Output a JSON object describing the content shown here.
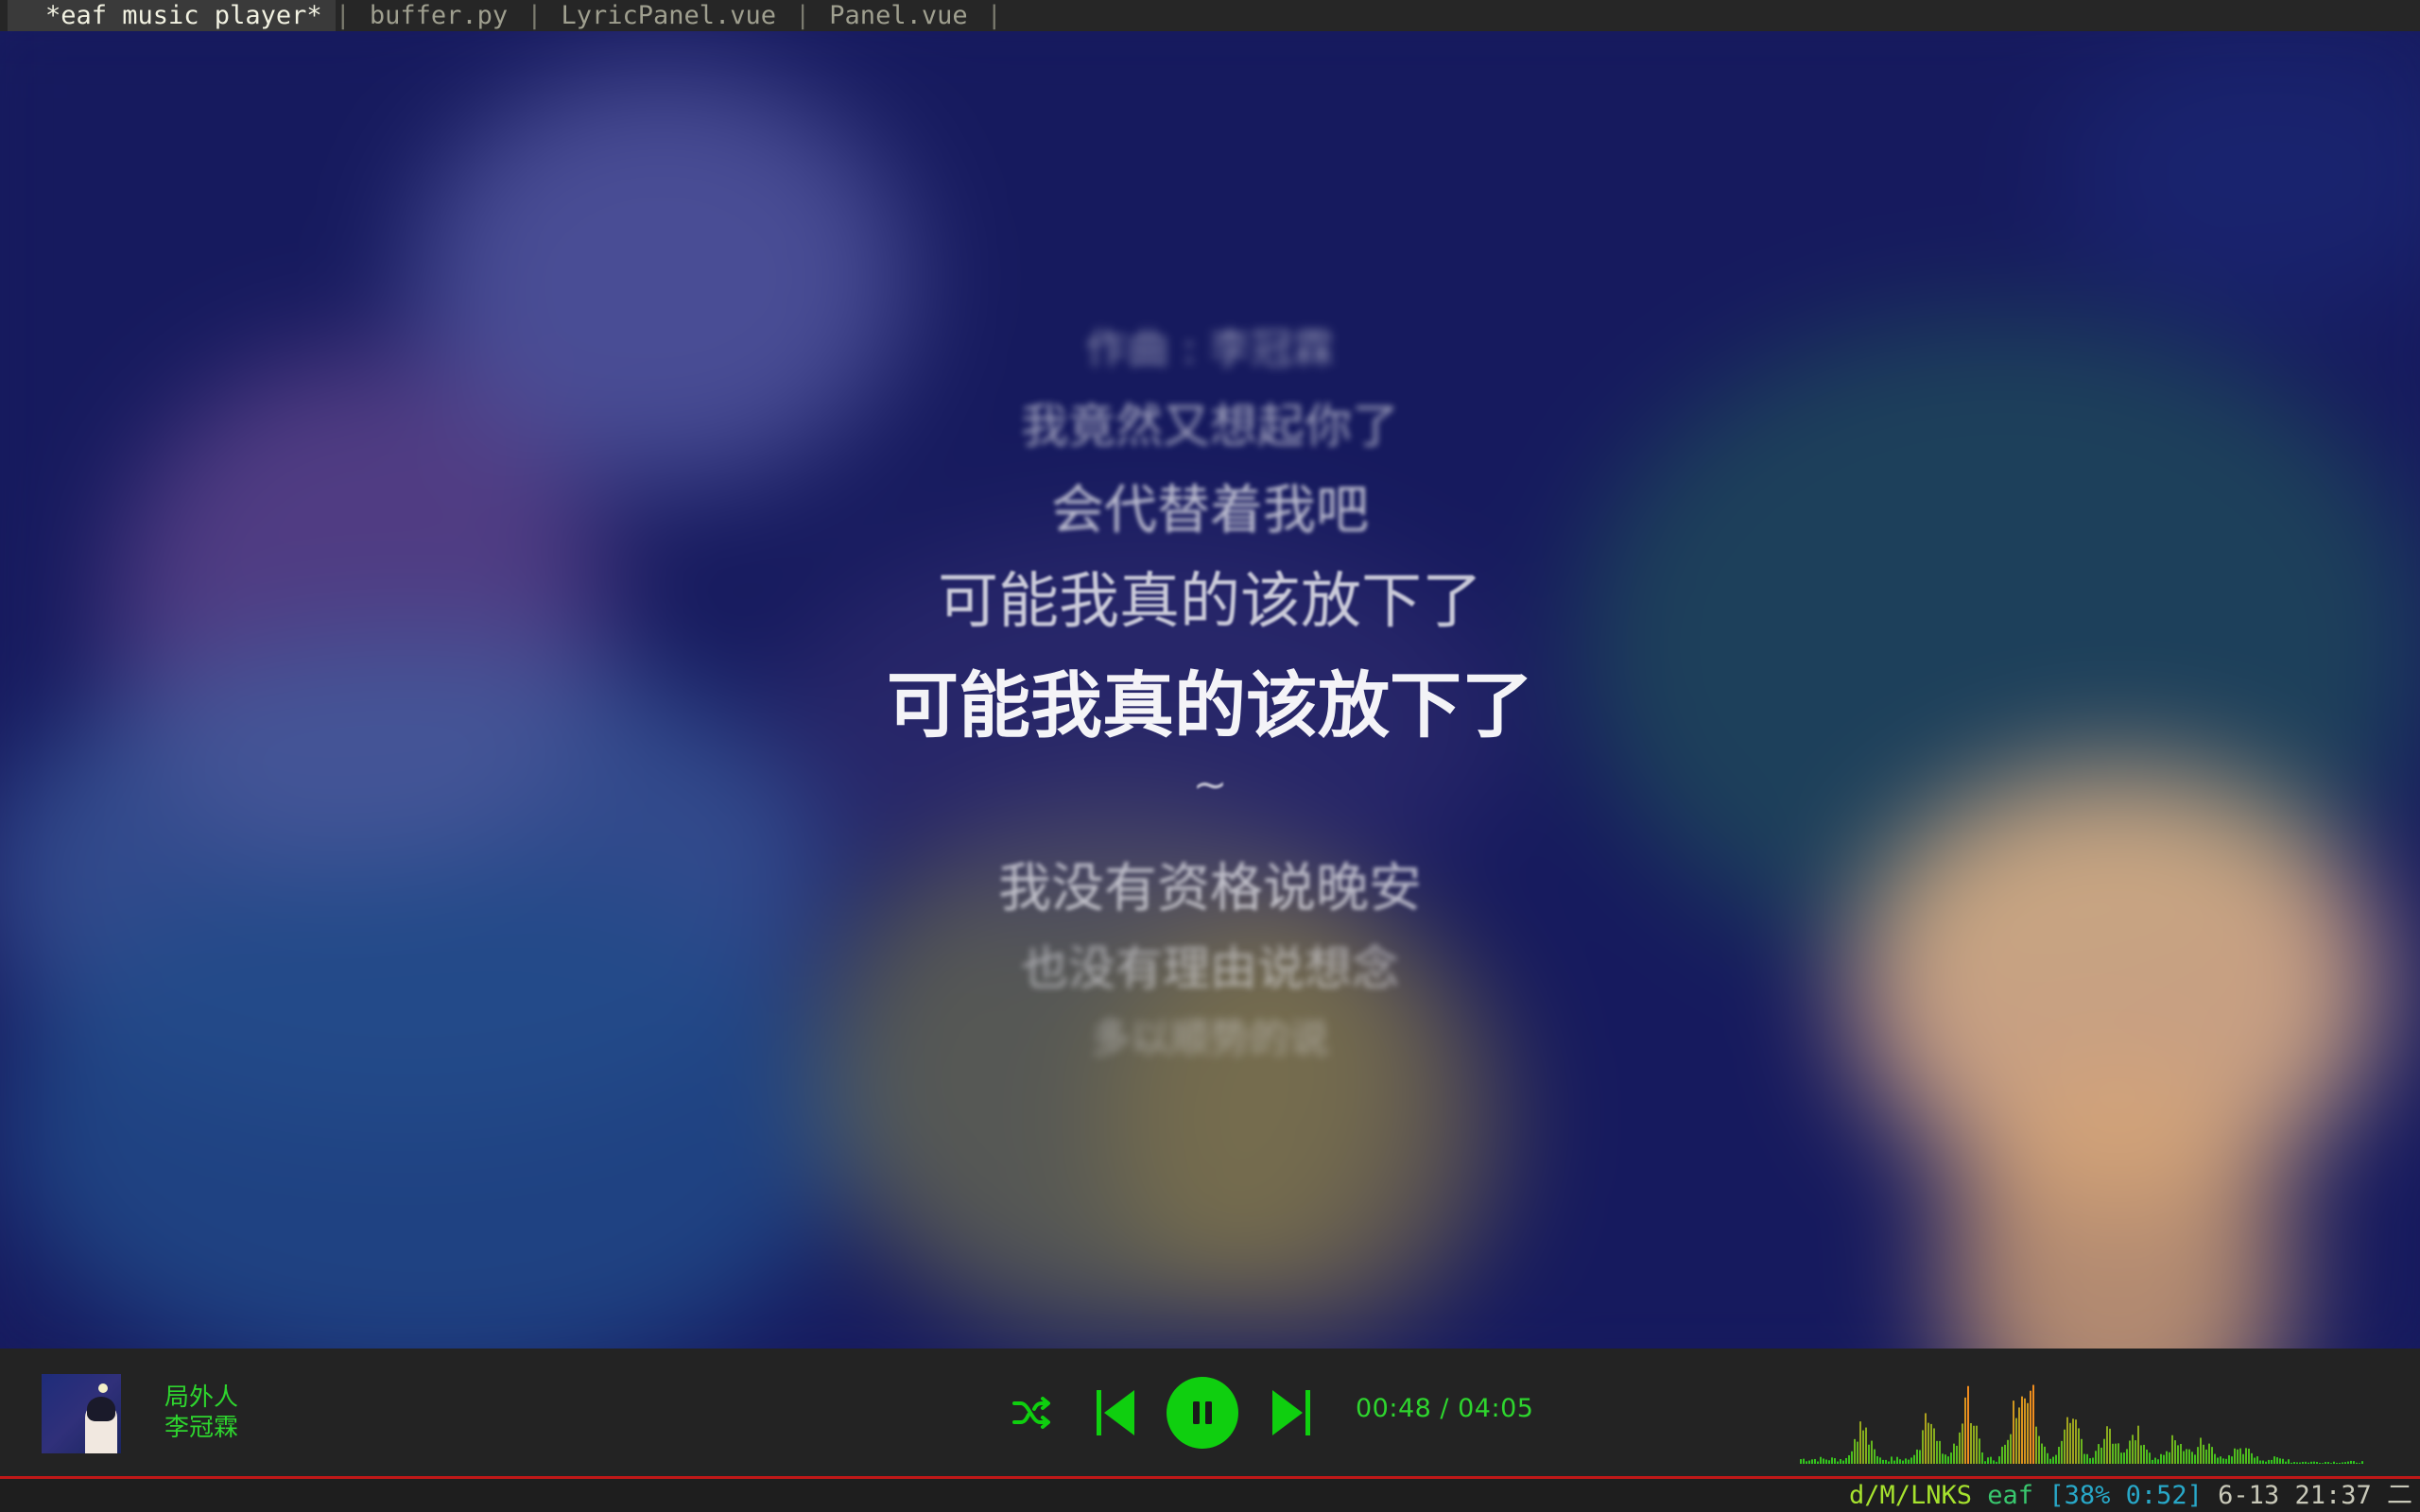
{
  "tabs": [
    {
      "label": "*eaf music player*",
      "active": true
    },
    {
      "label": "buffer.py",
      "active": false
    },
    {
      "label": "LyricPanel.vue",
      "active": false
    },
    {
      "label": "Panel.vue",
      "active": false
    }
  ],
  "tab_separator": "|",
  "lyrics": {
    "lines": [
      "作曲 : 李冠霖",
      "我竟然又想起你了",
      "会代替着我吧",
      "可能我真的该放下了",
      "可能我真的该放下了",
      "~",
      "我没有资格说晚安",
      "也没有理由说想念",
      "多以顺势的说"
    ],
    "current_index": 4
  },
  "player": {
    "song_title": "局外人",
    "artist": "李冠霖",
    "cover_glyph": "局外人",
    "current_time": "00:48",
    "time_separator": "/",
    "total_time": "04:05",
    "state": "playing",
    "icons": {
      "shuffle": "shuffle-icon",
      "prev": "skip-previous-icon",
      "play_pause": "pause-icon",
      "next": "skip-next-icon"
    },
    "accent_color": "#0fcf0f",
    "text_color": "#2ed52e"
  },
  "modeline": {
    "mode": "d/M/LNKS",
    "buffer": "eaf",
    "battery": "[38% 0:52]",
    "datetime": "6-13 21:37",
    "workspace": "二"
  }
}
